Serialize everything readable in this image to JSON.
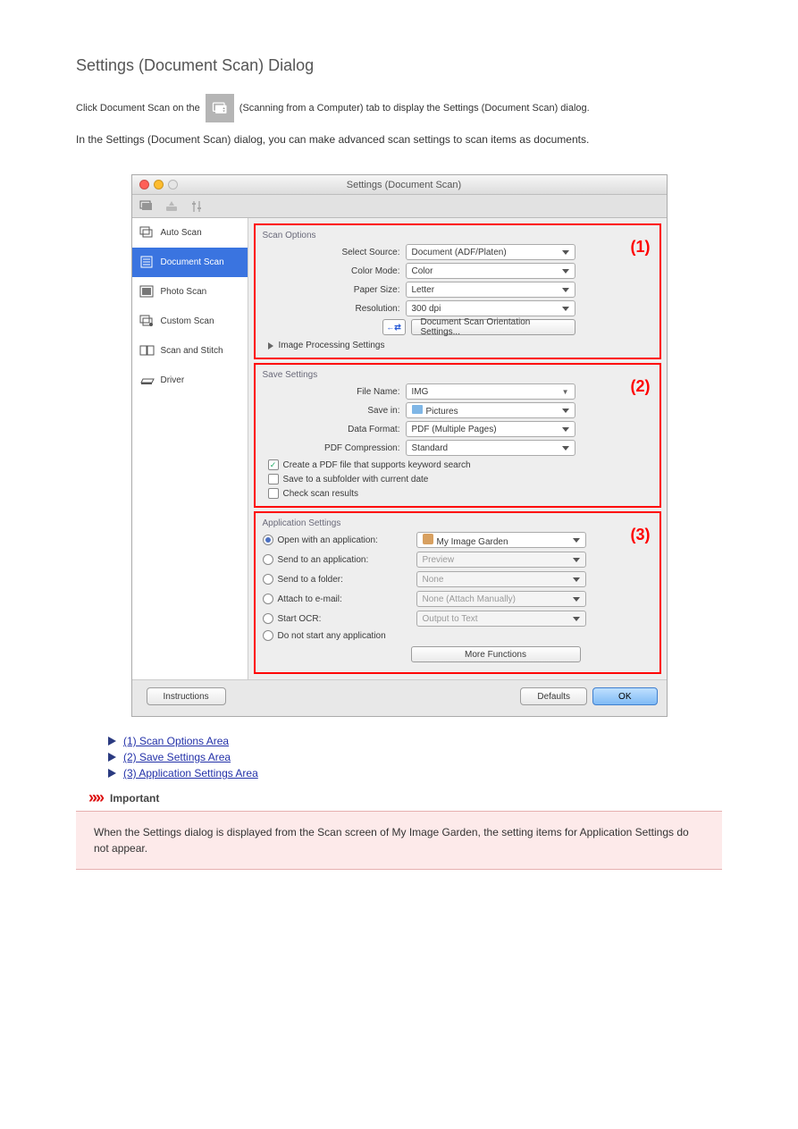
{
  "page": {
    "title": "Settings (Document Scan) Dialog",
    "intro1": "Click Document Scan on the",
    "intro2": "(Scanning from a Computer) tab to display the Settings (Document Scan) dialog.",
    "intro3": "In the Settings (Document Scan) dialog, you can make advanced scan settings to scan items as documents."
  },
  "dialog": {
    "title": "Settings (Document Scan)",
    "sidebar": [
      "Auto Scan",
      "Document Scan",
      "Photo Scan",
      "Custom Scan",
      "Scan and Stitch",
      "Driver"
    ],
    "selected_index": 1
  },
  "scan_options": {
    "section_title": "Scan Options",
    "num": "(1)",
    "select_source_label": "Select Source:",
    "select_source": "Document (ADF/Platen)",
    "color_mode_label": "Color Mode:",
    "color_mode": "Color",
    "paper_size_label": "Paper Size:",
    "paper_size": "Letter",
    "resolution_label": "Resolution:",
    "resolution": "300 dpi",
    "orientation_button": "Document Scan Orientation Settings...",
    "swap_icon_label": "←⇄",
    "img_proc": "Image Processing Settings"
  },
  "save_settings": {
    "section_title": "Save Settings",
    "num": "(2)",
    "file_name_label": "File Name:",
    "file_name": "IMG",
    "save_in_label": "Save in:",
    "save_in": "Pictures",
    "data_format_label": "Data Format:",
    "data_format": "PDF (Multiple Pages)",
    "pdf_comp_label": "PDF Compression:",
    "pdf_comp": "Standard",
    "cb1": "Create a PDF file that supports keyword search",
    "cb2": "Save to a subfolder with current date",
    "cb3": "Check scan results"
  },
  "app_settings": {
    "section_title": "Application Settings",
    "num": "(3)",
    "opt1_label": "Open with an application:",
    "opt1_val": "My Image Garden",
    "opt2_label": "Send to an application:",
    "opt2_val": "Preview",
    "opt3_label": "Send to a folder:",
    "opt3_val": "None",
    "opt4_label": "Attach to e-mail:",
    "opt4_val": "None (Attach Manually)",
    "opt5_label": "Start OCR:",
    "opt5_val": "Output to Text",
    "opt6_label": "Do not start any application",
    "more_functions": "More Functions"
  },
  "buttons": {
    "instructions": "Instructions",
    "defaults": "Defaults",
    "ok": "OK"
  },
  "toc": {
    "l1": "(1) Scan Options Area",
    "l2": "(2) Save Settings Area",
    "l3": "(3) Application Settings Area"
  },
  "important": {
    "label": "Important",
    "text": "When the Settings dialog is displayed from the Scan screen of My Image Garden, the setting items for Application Settings do not appear."
  }
}
